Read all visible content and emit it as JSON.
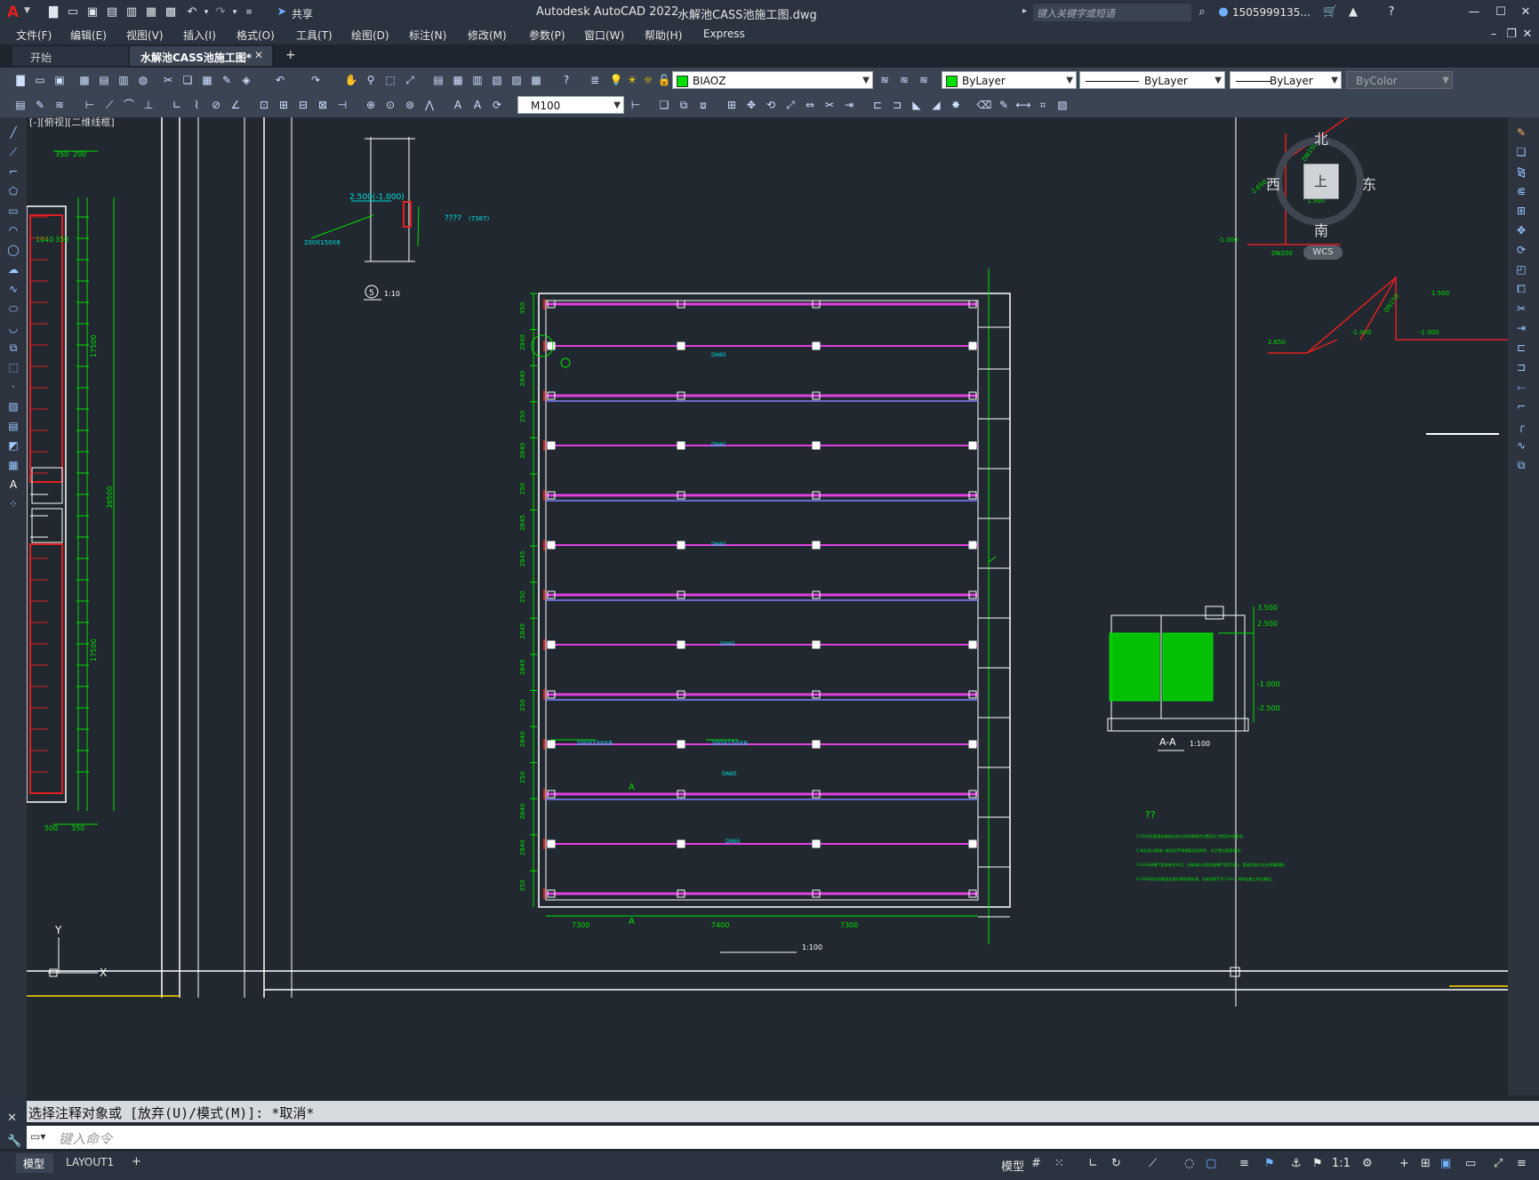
{
  "app": {
    "logo": "A",
    "title": "Autodesk AutoCAD 2022",
    "filename": "水解池CASS池施工图.dwg",
    "share_label": "共享",
    "search_placeholder": "键入关键字或短语",
    "user": "1505999135...",
    "help": "?"
  },
  "menu": [
    "文件(F)",
    "编辑(E)",
    "视图(V)",
    "插入(I)",
    "格式(O)",
    "工具(T)",
    "绘图(D)",
    "标注(N)",
    "修改(M)",
    "参数(P)",
    "窗口(W)",
    "帮助(H)",
    "Express"
  ],
  "tabs": {
    "start": "开始",
    "active": "水解池CASS池施工图*",
    "add": "+"
  },
  "toolbar": {
    "layer": "BIAOZ",
    "color": "ByLayer",
    "linetype": "ByLayer",
    "lineweight": "ByLayer",
    "plotstyle": "ByColor",
    "dimstyle": "M100"
  },
  "viewport_label": "[-][俯视][二维线框]",
  "viewcube": {
    "north": "北",
    "south": "南",
    "east": "东",
    "west": "西",
    "top": "上",
    "wcs": "WCS"
  },
  "drawing": {
    "detail_label": "1:10",
    "detail_num": "5",
    "detail_elev": "2.500(-1.000)",
    "detail_qq": "????",
    "detail_code": "(7387)",
    "detail_200": "200X150X8",
    "dims_left_v": [
      "350",
      "2840",
      "2840",
      "250",
      "2840",
      "250",
      "2845",
      "2845",
      "250",
      "2845",
      "2845",
      "250",
      "2840",
      "250",
      "2840",
      "2840",
      "350"
    ],
    "pipe_labels": [
      "DN65",
      "DN65",
      "DN65",
      "DN65",
      "DN65",
      "DN65"
    ],
    "plate_label": "200X150X8",
    "plan_dims": [
      "7300",
      "7400",
      "7300"
    ],
    "section_a": "A",
    "plan_scale": "1:100",
    "section_title": "A-A",
    "section_scale": "1:100",
    "section_elev": [
      "3.500",
      "2.500",
      "-1.000",
      "-2.500"
    ],
    "notes_title": "??",
    "notes": [
      "1.CASS池管道安装前应核对所有预埋件位置及尺寸是否符合要求；",
      "2.本池设计管道一般采用不锈钢管及其附件，法兰等应配套使用；",
      "3.CASS池曝气管安装完毕后，应做清水试验检查曝气是否均匀，管道及接口应无渗漏现象；",
      "4.CASS池内部管道支架应做防腐处理，支架间距不大于2m，具体由施工单位确定。"
    ],
    "right_dims": [
      "DN150",
      "1.500",
      "2.650",
      "-1.000",
      "DN200",
      "DN150",
      "1.500",
      "-1.000",
      "-1.000",
      "2.650"
    ],
    "ext_dims": [
      "350",
      "200",
      "1640",
      "350",
      "17500",
      "36500",
      "17500",
      "500",
      "350"
    ],
    "ucs_y": "Y",
    "ucs_x": "X"
  },
  "command": {
    "history": "选择注释对象或 [放弃(U)/模式(M)]: *取消*",
    "placeholder": "键入命令"
  },
  "status": {
    "model": "模型",
    "layout": "LAYOUT1",
    "add": "+",
    "model_btn": "模型",
    "scale": "1:1"
  }
}
